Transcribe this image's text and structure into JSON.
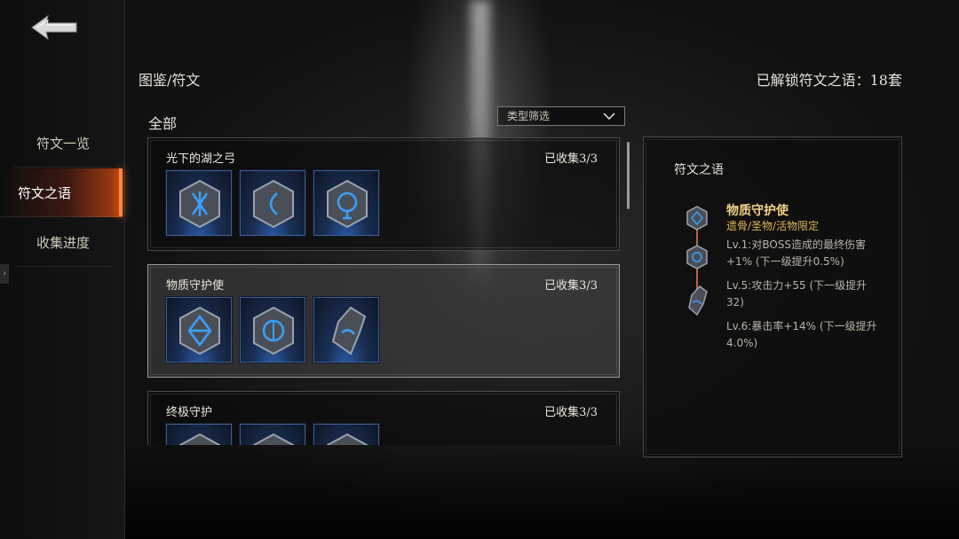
{
  "sidebar": {
    "items": [
      {
        "label": "符文一览"
      },
      {
        "label": "符文之语"
      },
      {
        "label": "收集进度"
      }
    ],
    "side_tab_label": "›"
  },
  "header": {
    "breadcrumb": "图鉴/符文",
    "unlock_text": "已解锁符文之语：18套"
  },
  "list": {
    "section_title": "全部",
    "filter_label": "类型筛选",
    "sets": [
      {
        "name": "光下的湖之弓",
        "count": "已收集3/3",
        "runes": [
          "rune-x-icon",
          "rune-curve-icon",
          "rune-circle-icon"
        ]
      },
      {
        "name": "物质守护使",
        "count": "已收集3/3",
        "runes": [
          "rune-diamond-icon",
          "rune-circle-icon",
          "rune-shard-icon"
        ]
      },
      {
        "name": "终极守护",
        "count": "已收集3/3",
        "runes": [
          "rune-a-icon",
          "rune-b-icon",
          "rune-c-icon"
        ]
      }
    ]
  },
  "detail": {
    "title": "符文之语",
    "set_name": "物质守护使",
    "set_subtitle": "遗骨/圣物/活物限定",
    "effects": [
      "Lv.1:对BOSS造成的最终伤害+1% (下一级提升0.5%)",
      "Lv.5:攻击力+55 (下一级提升32)",
      "Lv.6:暴击率+14% (下一级提升4.0%)"
    ]
  },
  "colors": {
    "accent_orange": "#ff8a3a",
    "gold_title": "#f2d28a",
    "rune_glow": "#3aa0ff"
  }
}
